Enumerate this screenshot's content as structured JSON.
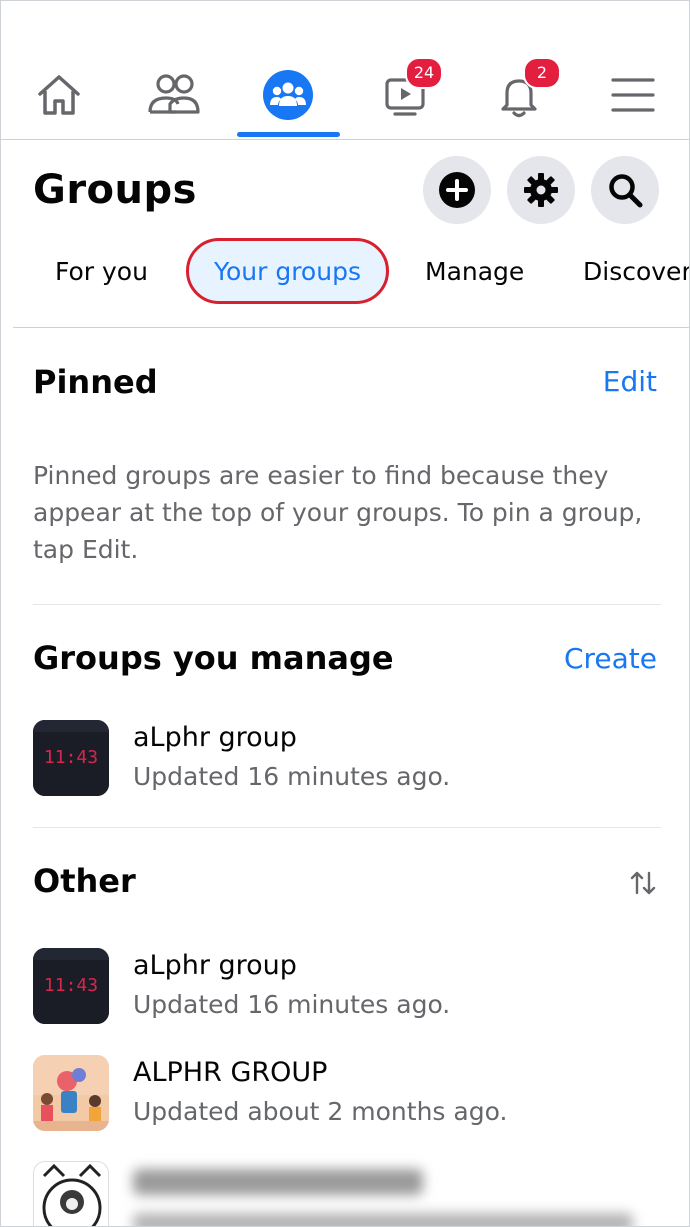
{
  "nav": {
    "watch_badge": "24",
    "notifications_badge": "2",
    "icons": [
      "home-icon",
      "friends-icon",
      "groups-icon",
      "watch-icon",
      "bell-icon",
      "menu-icon"
    ],
    "accent": "#1877f2",
    "badge_color": "#e41e3f"
  },
  "header": {
    "title": "Groups"
  },
  "tabs": {
    "for_you": "For you",
    "your_groups": "Your groups",
    "manage": "Manage",
    "discover": "Discover"
  },
  "pinned": {
    "title": "Pinned",
    "edit_label": "Edit",
    "helper": "Pinned groups are easier to find because they appear at the top of your groups. To pin a group, tap Edit."
  },
  "manage_section": {
    "title": "Groups you manage",
    "create_label": "Create",
    "groups": [
      {
        "name": "aLphr group",
        "updated": "Updated 16 minutes ago.",
        "thumb_text": "11:43"
      }
    ]
  },
  "other_section": {
    "title": "Other",
    "sort_icon": "sort-icon",
    "groups": [
      {
        "name": "aLphr group",
        "updated": "Updated 16 minutes ago.",
        "thumb_text": "11:43"
      },
      {
        "name": "ALPHR GROUP",
        "updated": "Updated about 2 months ago."
      }
    ]
  }
}
